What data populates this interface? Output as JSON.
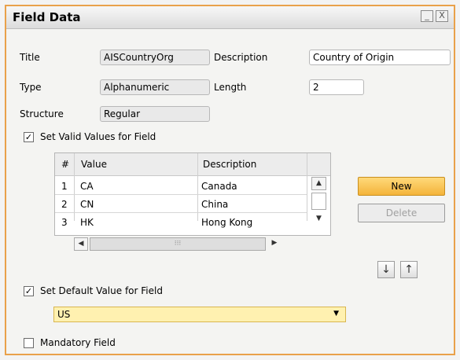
{
  "window": {
    "title": "Field Data",
    "minimize_label": "_",
    "close_label": "X"
  },
  "form": {
    "title_label": "Title",
    "title_value": "AISCountryOrg",
    "description_label": "Description",
    "description_value": "Country of Origin",
    "type_label": "Type",
    "type_value": "Alphanumeric",
    "length_label": "Length",
    "length_value": "2",
    "structure_label": "Structure",
    "structure_value": "Regular"
  },
  "valid_values": {
    "checkbox_label": "Set Valid Values for Field",
    "checked": true,
    "columns": [
      "#",
      "Value",
      "Description"
    ],
    "rows": [
      {
        "num": "1",
        "value": "CA",
        "description": "Canada"
      },
      {
        "num": "2",
        "value": "CN",
        "description": "China"
      },
      {
        "num": "3",
        "value": "HK",
        "description": "Hong Kong"
      }
    ],
    "new_button": "New",
    "delete_button": "Delete",
    "move_down_glyph": "↓",
    "move_up_glyph": "↑"
  },
  "default_value": {
    "checkbox_label": "Set Default Value for Field",
    "checked": true,
    "selected": "US"
  },
  "mandatory": {
    "checkbox_label": "Mandatory Field",
    "checked": false
  }
}
